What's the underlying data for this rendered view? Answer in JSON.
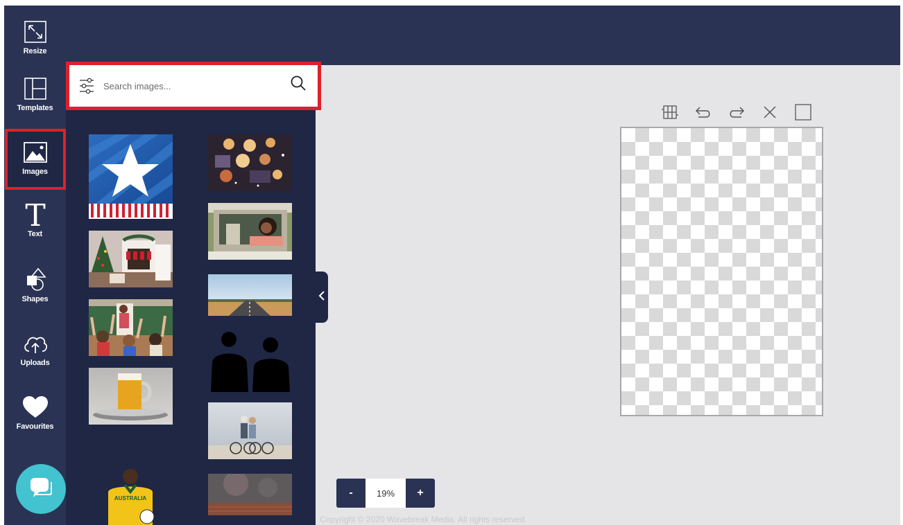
{
  "rail": {
    "items": [
      {
        "label": "Resize",
        "icon": "resize-icon"
      },
      {
        "label": "Templates",
        "icon": "templates-icon"
      },
      {
        "label": "Images",
        "icon": "image-icon"
      },
      {
        "label": "Text",
        "icon": "text-icon"
      },
      {
        "label": "Shapes",
        "icon": "shapes-icon"
      },
      {
        "label": "Uploads",
        "icon": "upload-cloud-icon"
      },
      {
        "label": "Favourites",
        "icon": "heart-icon"
      }
    ],
    "active": "Images",
    "chat_icon": "chat-icon"
  },
  "images_panel": {
    "search": {
      "placeholder": "Search images...",
      "value": ""
    },
    "thumbnails": [
      {
        "subject": "star-flag-graphic"
      },
      {
        "subject": "candles-flatlay"
      },
      {
        "subject": "christmas-fireplace"
      },
      {
        "subject": "woman-in-car"
      },
      {
        "subject": "classroom-raised-hands"
      },
      {
        "subject": "open-road-landscape"
      },
      {
        "subject": "beer-mug"
      },
      {
        "subject": "two-silhouettes"
      },
      {
        "subject": "couple-with-bicycles-beach"
      },
      {
        "subject": "soccer-player-australia"
      },
      {
        "subject": "stage-wall"
      }
    ],
    "soccer_jersey_text": "AUSTRALIA"
  },
  "canvas": {
    "tools": [
      "grid-icon",
      "undo-icon",
      "redo-icon",
      "close-icon",
      "square-icon"
    ],
    "zoom": {
      "minus_label": "-",
      "value": "19%",
      "plus_label": "+"
    }
  },
  "footer": {
    "copyright": "Copyright © 2020 Wavebreak Media. All rights reserved."
  },
  "colors": {
    "navy": "#2a3354",
    "panel": "#1f2745",
    "highlight": "#e0202a",
    "chat": "#43c2cf",
    "canvas_bg": "#e5e5e7"
  }
}
